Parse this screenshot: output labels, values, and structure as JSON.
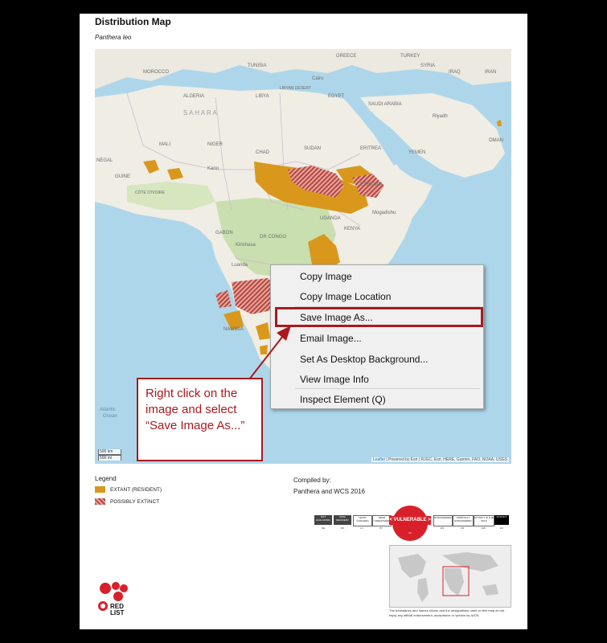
{
  "document": {
    "title": "Distribution Map",
    "species": "Panthera leo"
  },
  "map": {
    "attribution_link": "Leaflet",
    "attribution_text": "| Powered by Esri | RJGC, Esri, HERE, Garmin, FAO, NOAA, USGS",
    "scale_km": "500 km",
    "scale_mi": "500 mi",
    "labels": {
      "greece": "GREECE",
      "turkey": "TURKEY",
      "tunisia": "TUNISIA",
      "syria": "SYRIA",
      "iraq": "IRAQ",
      "iran": "IRAN",
      "morocco": "MOROCCO",
      "algeria": "ALGERIA",
      "libya": "LIBYA",
      "egypt": "EGYPT",
      "cairo": "Cairo",
      "libyan_desert": "LIBYAN DESERT",
      "sahara": "S A H A R A",
      "saudi": "SAUDI ARABIA",
      "riyadh": "Riyadh",
      "mali": "MALI",
      "niger": "NIGER",
      "chad": "CHAD",
      "sudan": "SUDAN",
      "eritrea": "ERITREA",
      "yemen": "YEMEN",
      "oman": "OMAN",
      "senegal": "NEGAL",
      "guinea": "GUINE",
      "cote": "CÔTE D'IVOIRE",
      "kano": "Kano",
      "ethiopia": "ETHIOPIA",
      "gabon": "GABON",
      "drcongo": "DR CONGO",
      "kinshasa": "Kinshasa",
      "uganda": "UGANDA",
      "kenya": "KENYA",
      "mogadishu": "Mogadishu",
      "luanda": "Luanda",
      "namibia": "NAMIBIA",
      "atlantic1": "Atlantic",
      "atlantic2": "Ocean"
    }
  },
  "legend": {
    "title": "Legend",
    "extant": "EXTANT (RESIDENT)",
    "extinct": "POSSIBLY EXTINCT"
  },
  "compiled": {
    "label": "Compiled by:",
    "value": "Panthera and WCS 2016"
  },
  "redlist": {
    "status_label": "< VULNERABLE >",
    "status_abbr": "VU",
    "logo_text": "RED LIST",
    "categories": [
      {
        "label": "NOT EVALUATED",
        "abbr": "NE"
      },
      {
        "label": "DATA DEFICIENT",
        "abbr": "DD"
      },
      {
        "label": "LEAST CONCERN",
        "abbr": "LC"
      },
      {
        "label": "NEAR THREATENED",
        "abbr": "NT"
      },
      {
        "label": "ENDANGERED",
        "abbr": "EN"
      },
      {
        "label": "CRITICALLY ENDANGERED",
        "abbr": "CR"
      },
      {
        "label": "EXTINCT IN THE WILD",
        "abbr": "EW"
      },
      {
        "label": "EXTINCT",
        "abbr": "EX"
      }
    ]
  },
  "inset_note": "The boundaries and names shown and the designations used on this map do not imply any official endorsement, acceptance or opinion by IUCN.",
  "context_menu": {
    "items": [
      "Copy Image",
      "Copy Image Location",
      "Save Image As...",
      "Email Image...",
      "Set As Desktop Background...",
      "View Image Info",
      "Inspect Element (Q)"
    ],
    "highlighted_index": 2
  },
  "callout": {
    "text": "Right click on the image and select “Save Image As...”",
    "color": "#a9191e"
  },
  "colors": {
    "extant": "#d9981c",
    "extinct": "#b9453b",
    "vulnerable": "#d8202a"
  }
}
